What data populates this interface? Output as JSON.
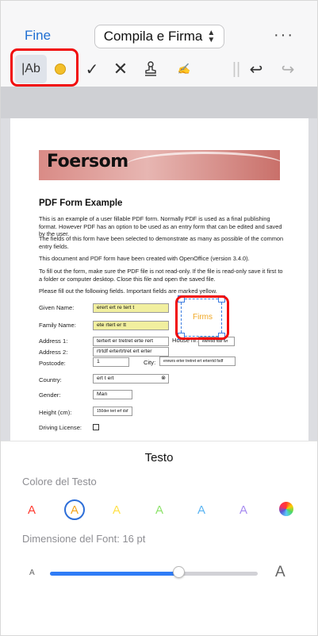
{
  "header": {
    "done_label": "Fine",
    "mode_label": "Compila e Firma",
    "more_label": "···"
  },
  "toolbar": {
    "text_tool_label": "|Ab",
    "check_label": "✓",
    "cross_label": "✕",
    "signature_label": "✍",
    "divider_label": "||",
    "undo_label": "↩",
    "redo_label": "↪",
    "active_color": "#f3bf2a"
  },
  "document": {
    "banner_title": "Foersom",
    "heading": "PDF Form Example",
    "paragraphs": [
      "This is an example of a user fillable PDF form. Normally PDF is used as a final publishing format. However PDF has an option to be used as an entry form that can be edited and saved by the user.",
      "The fields of this form have been selected to demonstrate as many as possible of the common entry fields.",
      "This document and PDF form have been created with OpenOffice (version 3.4.0).",
      "To fill out the form, make sure the PDF file is not read-only. If the file is read-only save it first to a folder or computer desktop. Close this file and open the saved file.",
      "Please fill out the following fields. Important fields are marked yellow."
    ],
    "labels": {
      "given_name": "Given Name:",
      "family_name": "Family Name:",
      "address1": "Address 1:",
      "address2": "Address 2:",
      "postcode": "Postcode:",
      "country": "Country:",
      "gender": "Gender:",
      "height": "Height (cm):",
      "driving": "Driving License:",
      "house_nr": "House nr:",
      "city": "City:"
    },
    "values": {
      "given_name": "erert ert re tert t",
      "family_name": "ete rtert er tt",
      "address1": "tertert er tretret  erte rert",
      "address2": "rtrtdf ertertrtret ert erter",
      "postcode": "1",
      "house_nr": "ewresd fdsf wr",
      "city": "erewrs erter tretret ert erterrtd fsdf",
      "country": "ert t ert",
      "gender": "Man",
      "height": "150der tert erf dsf"
    },
    "signature_text": "Firms"
  },
  "panel": {
    "title": "Testo",
    "color_section": "Colore del Testo",
    "swatch_letter": "A",
    "colors": [
      "#ff3b30",
      "#f3a41b",
      "#ffe14a",
      "#8de36a",
      "#5ab4f2",
      "#a78bf0"
    ],
    "selected_color_index": 1,
    "font_size_label": "Dimensione del Font: 16 pt",
    "font_size_pt": 16,
    "slider_fraction": 0.62,
    "small_a": "A",
    "large_a": "A"
  }
}
